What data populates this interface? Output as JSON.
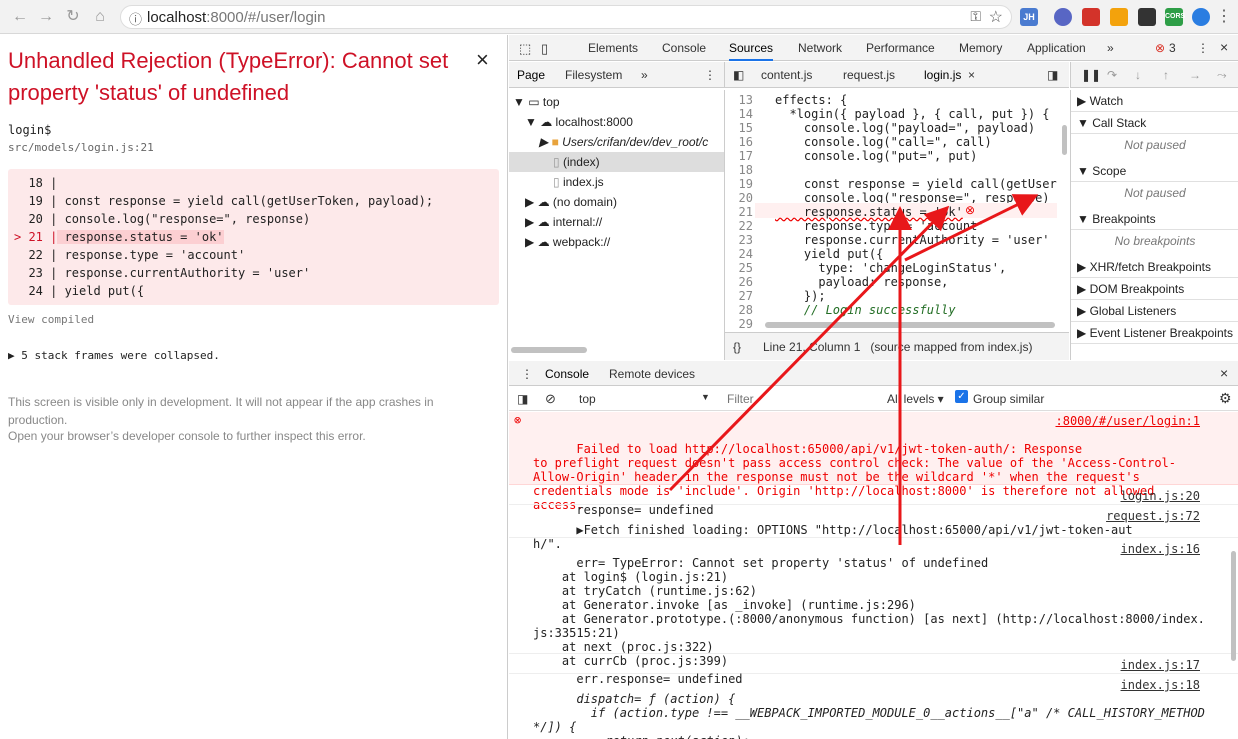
{
  "browser": {
    "url_host": "localhost",
    "url_rest": ":8000/#/user/login",
    "extensions": [
      "JH",
      "CORS"
    ]
  },
  "overlay": {
    "title": "Unhandled Rejection (TypeError): Cannot set property 'status' of undefined",
    "fn": "login$",
    "file": "src/models/login.js:21",
    "code_lines": [
      {
        "n": "  18 |",
        "t": ""
      },
      {
        "n": "  19 |",
        "t": " const response = yield call(getUserToken, payload);"
      },
      {
        "n": "  20 |",
        "t": " console.log(\"response=\", response)"
      },
      {
        "n": "> 21 |",
        "t": " response.status = 'ok'"
      },
      {
        "n": "  22 |",
        "t": " response.type = 'account'"
      },
      {
        "n": "  23 |",
        "t": " response.currentAuthority = 'user'"
      },
      {
        "n": "  24 |",
        "t": " yield put({"
      }
    ],
    "view_compiled": "View compiled",
    "collapsed": "▶ 5 stack frames were collapsed.",
    "note1": "This screen is visible only in development. It will not appear if the app crashes in production.",
    "note2": "Open your browser’s developer console to further inspect this error."
  },
  "devtools": {
    "tabs": [
      "Elements",
      "Console",
      "Sources",
      "Network",
      "Performance",
      "Memory",
      "Application"
    ],
    "error_count": "3",
    "nav_tabs": [
      "Page",
      "Filesystem"
    ],
    "file_tabs": [
      "content.js",
      "request.js",
      "login.js"
    ],
    "tree": [
      "top",
      "localhost:8000",
      "Users/crifan/dev/dev_root/c",
      "(index)",
      "index.js",
      "(no domain)",
      "internal://",
      "webpack://"
    ],
    "source_lines": [
      {
        "n": "13",
        "t": "effects: {"
      },
      {
        "n": "14",
        "t": "  *login({ payload }, { call, put }) {"
      },
      {
        "n": "15",
        "t": "    console.log(\"payload=\", payload)"
      },
      {
        "n": "16",
        "t": "    console.log(\"call=\", call)"
      },
      {
        "n": "17",
        "t": "    console.log(\"put=\", put)"
      },
      {
        "n": "18",
        "t": ""
      },
      {
        "n": "19",
        "t": "    const response = yield call(getUser"
      },
      {
        "n": "20",
        "t": "    console.log(\"response=\", response)"
      },
      {
        "n": "21",
        "t": "    response.status = 'ok'"
      },
      {
        "n": "22",
        "t": "    response.type = 'account'"
      },
      {
        "n": "23",
        "t": "    response.currentAuthority = 'user'"
      },
      {
        "n": "24",
        "t": "    yield put({"
      },
      {
        "n": "25",
        "t": "      type: 'changeLoginStatus',"
      },
      {
        "n": "26",
        "t": "      payload: response,"
      },
      {
        "n": "27",
        "t": "    });"
      },
      {
        "n": "28",
        "t": "    // Login successfully"
      },
      {
        "n": "29",
        "t": ""
      }
    ],
    "status_bar": "Line 21, Column 1   (source mapped from index.js)",
    "sidebar": [
      "Watch",
      "Call Stack",
      "Scope",
      "Breakpoints",
      "XHR/fetch Breakpoints",
      "DOM Breakpoints",
      "Global Listeners",
      "Event Listener Breakpoints"
    ],
    "not_paused": "Not paused",
    "no_breakpoints": "No breakpoints",
    "drawer_tabs": [
      "Console",
      "Remote devices"
    ],
    "context": "top",
    "filter_placeholder": "Filter",
    "levels": "All levels ▾",
    "group_similar": "Group similar",
    "console": [
      {
        "text": "Failed to load http://localhost:65000/api/v1/jwt-token-auth/: Response\nto preflight request doesn't pass access control check: The value of the 'Access-Control-\nAllow-Origin' header in the response must not be the wildcard '*' when the request's\ncredentials mode is 'include'. Origin 'http://localhost:8000' is therefore not allowed\naccess.",
        "src": ":8000/#/user/login:1"
      },
      {
        "text": "response= undefined",
        "src": "login.js:20"
      },
      {
        "text": "▶Fetch finished loading: OPTIONS \"http://localhost:65000/api/v1/jwt-token-aut\nh/\".",
        "src": "request.js:72"
      },
      {
        "text": "err= TypeError: Cannot set property 'status' of undefined\n    at login$ (login.js:21)\n    at tryCatch (runtime.js:62)\n    at Generator.invoke [as _invoke] (runtime.js:296)\n    at Generator.prototype.(:8000/anonymous function) [as next] (http://localhost:8000/index.\njs:33515:21)\n    at next (proc.js:322)\n    at currCb (proc.js:399)",
        "src": "index.js:16"
      },
      {
        "text": "err.response= undefined",
        "src": "index.js:17"
      },
      {
        "text": "dispatch= ƒ (action) {\n        if (action.type !== __WEBPACK_IMPORTED_MODULE_0__actions__[\"a\" /* CALL_HISTORY_METHOD\n*/]) {\n          return next(action);",
        "src": "index.js:18"
      }
    ]
  }
}
